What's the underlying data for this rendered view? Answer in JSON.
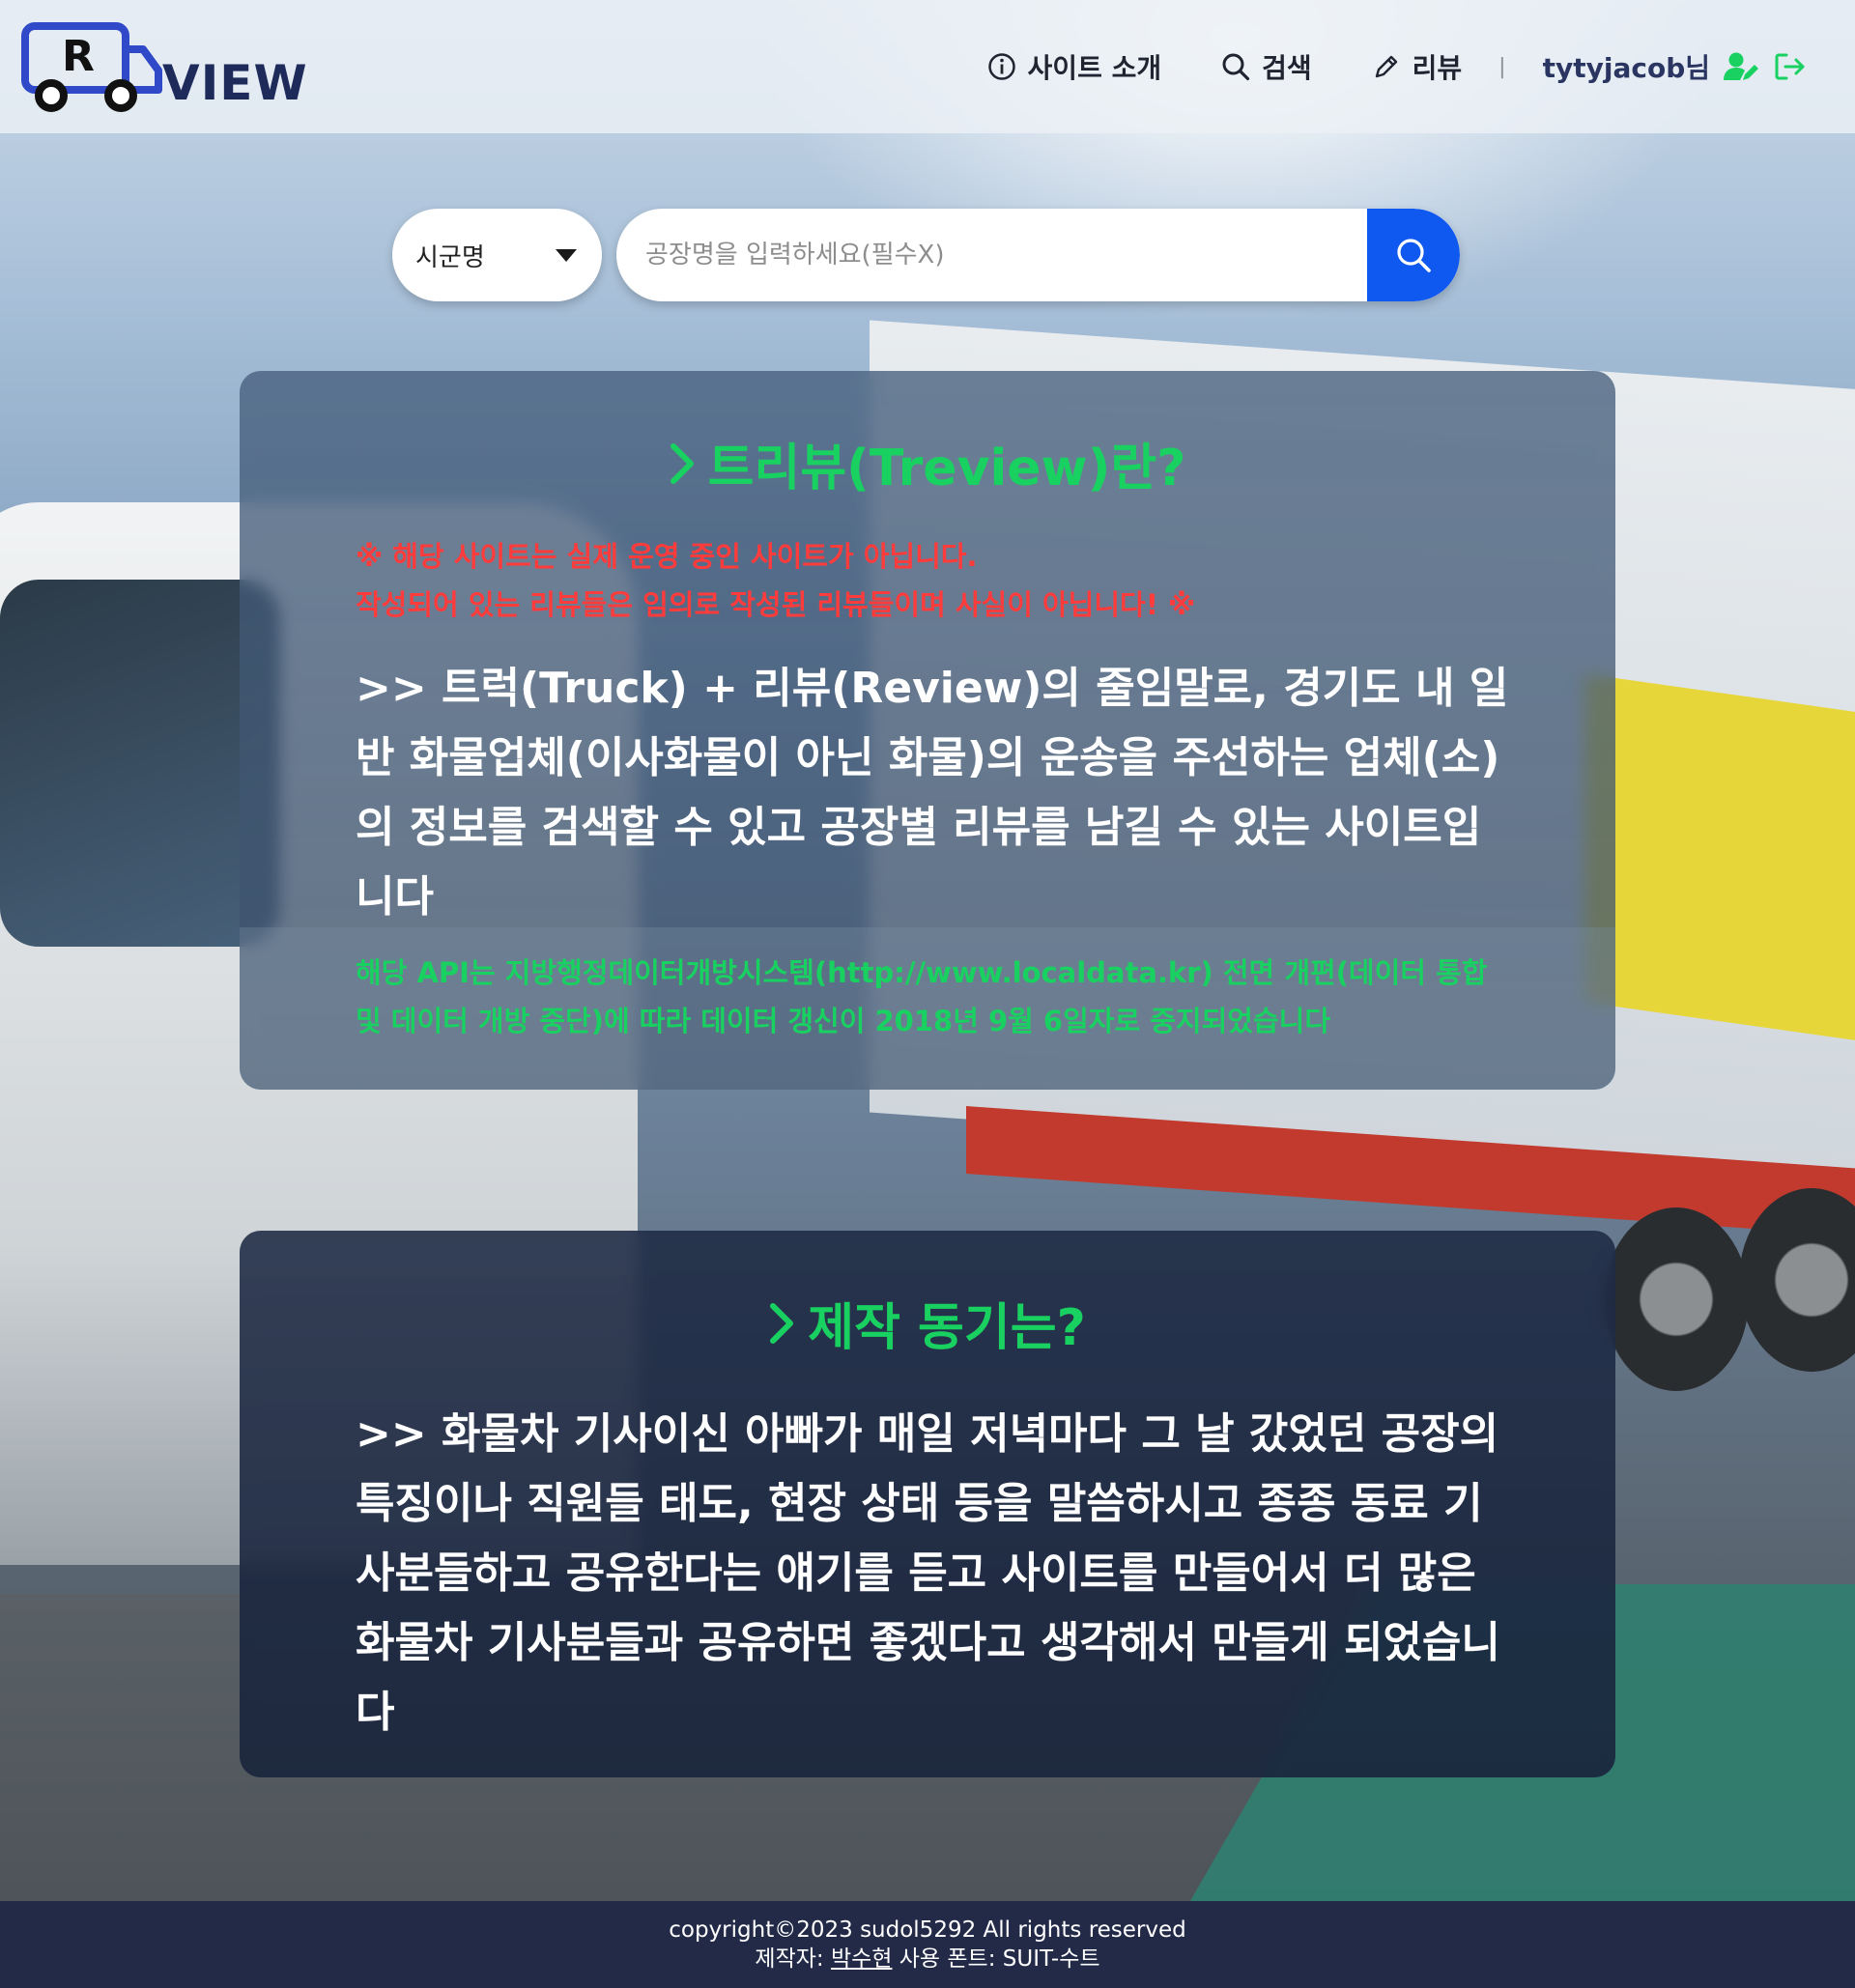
{
  "header": {
    "logo_letter": "R",
    "logo_text": "VIEW",
    "nav": [
      {
        "label": "사이트 소개",
        "icon": "info-icon"
      },
      {
        "label": "검색",
        "icon": "search-icon"
      },
      {
        "label": "리뷰",
        "icon": "pencil-icon"
      }
    ],
    "separator": "|",
    "user_name": "tytyjacob님",
    "user_icon": "user-edit-icon",
    "logout_icon": "logout-icon",
    "accent_color": "#19d160"
  },
  "search": {
    "select_value": "시군명",
    "placeholder": "공장명을 입력하세요(필수X)",
    "button_icon": "search-icon",
    "button_color": "#0f58f0"
  },
  "about": {
    "title": "트리뷰(Treview)란?",
    "warning_line1": "※ 해당 사이트는 실제 운영 중인 사이트가 아닙니다.",
    "warning_line2": "작성되어 있는 리뷰들은 임의로 작성된 리뷰들이며 사실이 아닙니다! ※",
    "description": ">> 트럭(Truck) + 리뷰(Review)의 줄임말로, 경기도 내 일반 화물업체(이사화물이 아닌 화물)의 운송을 주선하는 업체(소)의 정보를 검색할 수 있고 공장별 리뷰를 남길 수 있는 사이트입니다",
    "api_note": "해당 API는 지방행정데이터개방시스템(http://www.localdata.kr) 전면 개편(데이터 통합 및 데이터 개방 중단)에 따라 데이터 갱신이 2018년 9월 6일자로 중지되었습니다"
  },
  "motivation": {
    "title": "제작 동기는?",
    "description": ">> 화물차 기사이신 아빠가 매일 저녁마다 그 날 갔었던 공장의 특징이나 직원들 태도, 현장 상태 등을 말씀하시고 종종 동료 기사분들하고 공유한다는 얘기를 듣고 사이트를 만들어서 더 많은 화물차 기사분들과 공유하면 좋겠다고 생각해서 만들게 되었습니다"
  },
  "footer": {
    "copyright": "copyright©2023 sudol5292 All rights reserved",
    "author_label": "제작자:",
    "author_name": "박수현",
    "font_label": "사용 폰트: SUIT-수트"
  }
}
